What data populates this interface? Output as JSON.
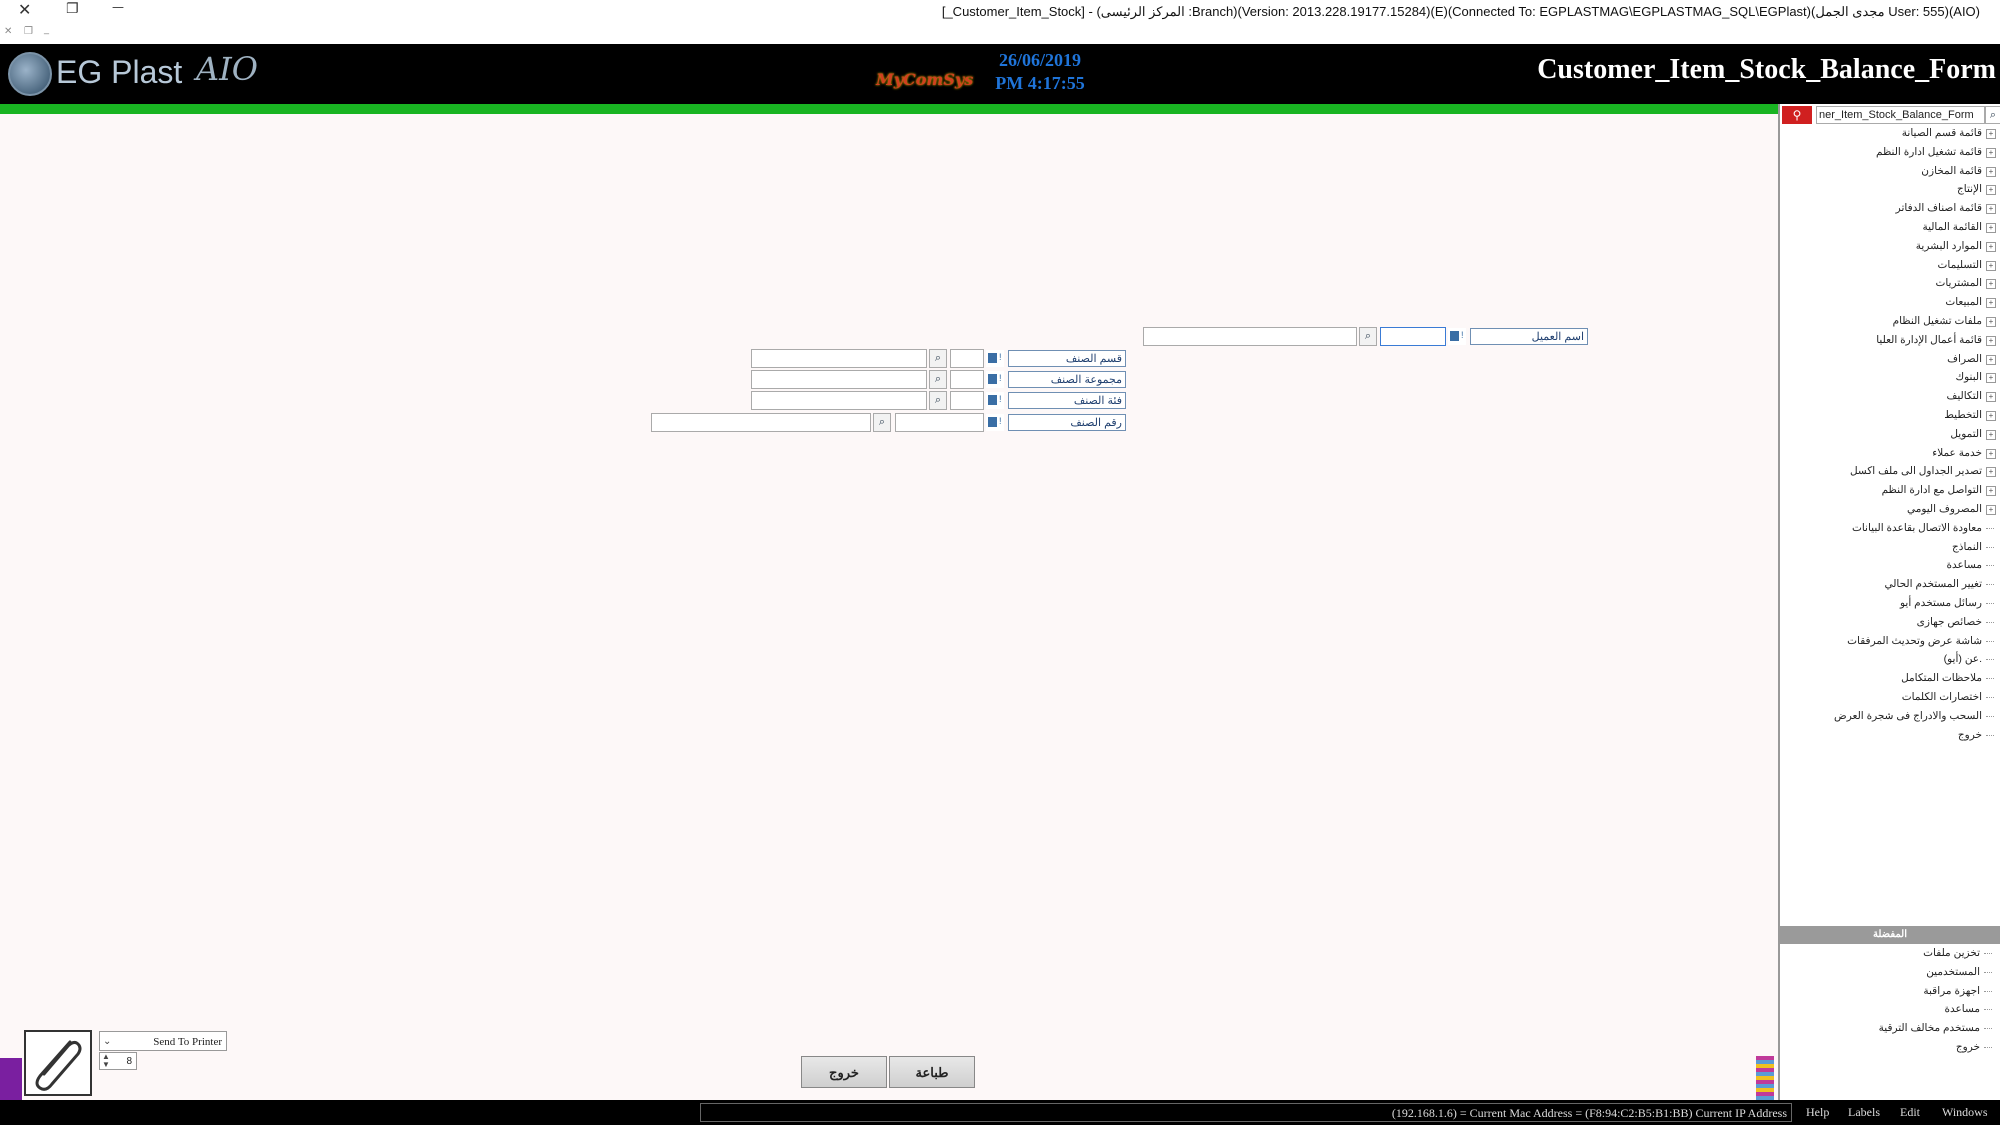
{
  "window": {
    "title": "[_Customer_Item_Stock] - (المركز الرئيسى :Branch)(Version: 2013.228.19177.15284)(E)(Connected To: EGPLASTMAG\\EGPLASTMAG_SQL\\EGPlast)(مجدى الجمل User: 555)(AIO)",
    "close_glyph": "✕",
    "restore_glyph": "❐",
    "minimize_glyph": "—"
  },
  "header": {
    "logo_text": "EG Plast",
    "logo_suffix": "AIO",
    "brand": "MyComSys",
    "date": "26/06/2019",
    "time": "PM 4:17:55",
    "form_title": "Customer_Item_Stock_Balance_Form"
  },
  "sidebar": {
    "search_value": "ner_Item_Stock_Balance_Form",
    "search_button_icon": "search-icon",
    "items": [
      {
        "label": "قائمة قسم الصيانة",
        "expandable": true
      },
      {
        "label": "قائمة تشغيل ادارة النظم",
        "expandable": true
      },
      {
        "label": "قائمة المخازن",
        "expandable": true
      },
      {
        "label": "الإنتاج",
        "expandable": true
      },
      {
        "label": "قائمة اصناف الدفاتر",
        "expandable": true
      },
      {
        "label": "القائمة المالية",
        "expandable": true
      },
      {
        "label": "الموارد البشرية",
        "expandable": true
      },
      {
        "label": "التسليمات",
        "expandable": true
      },
      {
        "label": "المشتريات",
        "expandable": true
      },
      {
        "label": "المبيعات",
        "expandable": true
      },
      {
        "label": "ملفات تشغيل النظام",
        "expandable": true
      },
      {
        "label": "قائمة أعمال الإدارة العليا",
        "expandable": true
      },
      {
        "label": "الصراف",
        "expandable": true
      },
      {
        "label": "البنوك",
        "expandable": true
      },
      {
        "label": "التكاليف",
        "expandable": true
      },
      {
        "label": "التخطيط",
        "expandable": true
      },
      {
        "label": "التمويل",
        "expandable": true
      },
      {
        "label": "خدمة عملاء",
        "expandable": true
      },
      {
        "label": "تصدير الجداول الى ملف اكسل",
        "expandable": true
      },
      {
        "label": "التواصل مع ادارة النظم",
        "expandable": true
      },
      {
        "label": "المصروف اليومي",
        "expandable": true
      },
      {
        "label": "معاودة الاتصال بقاعدة البيانات",
        "expandable": false
      },
      {
        "label": "النماذج",
        "expandable": false
      },
      {
        "label": "مساعدة",
        "expandable": false
      },
      {
        "label": "تغيير المستخدم الحالي",
        "expandable": false
      },
      {
        "label": "رسائل مستخدم أيو",
        "expandable": false
      },
      {
        "label": "خصائص جهازى",
        "expandable": false
      },
      {
        "label": "شاشة عرض وتحديث المرفقات",
        "expandable": false
      },
      {
        "label": "عن (أيو).",
        "expandable": false
      },
      {
        "label": "ملاحظات المتكامل",
        "expandable": false
      },
      {
        "label": "اختصارات الكلمات",
        "expandable": false
      },
      {
        "label": "السحب والادراج فى شجرة العرض",
        "expandable": false
      },
      {
        "label": "خروج",
        "expandable": false
      }
    ],
    "favorites_title": "المفضلة",
    "favorites": [
      {
        "label": "تخزين ملفات"
      },
      {
        "label": "المستخدمين"
      },
      {
        "label": "اجهزة مراقبة"
      },
      {
        "label": "مساعدة"
      },
      {
        "label": "مستخدم مخالف الترقية"
      },
      {
        "label": "خروج"
      }
    ]
  },
  "form": {
    "customer": {
      "label": "اسم العميل",
      "code": "",
      "name": ""
    },
    "item_section": {
      "label": "قسم الصنف",
      "code": "",
      "name": ""
    },
    "item_group": {
      "label": "مجموعة الصنف",
      "code": "",
      "name": ""
    },
    "item_category": {
      "label": "فئة الصنف",
      "code": "",
      "name": ""
    },
    "item_number": {
      "label": "رقم الصنف",
      "code": "",
      "name": ""
    }
  },
  "bottom": {
    "printer_label": "Send To Printer",
    "copies": "8",
    "print_button": "طباعة",
    "exit_button": "خروج"
  },
  "status": {
    "ip_text": "(192.168.1.6) = Current Mac Address = (F8:94:C2:B5:B1:BB) Current IP Address",
    "menus": [
      "Help",
      "Labels",
      "Edit",
      "Windows"
    ]
  }
}
